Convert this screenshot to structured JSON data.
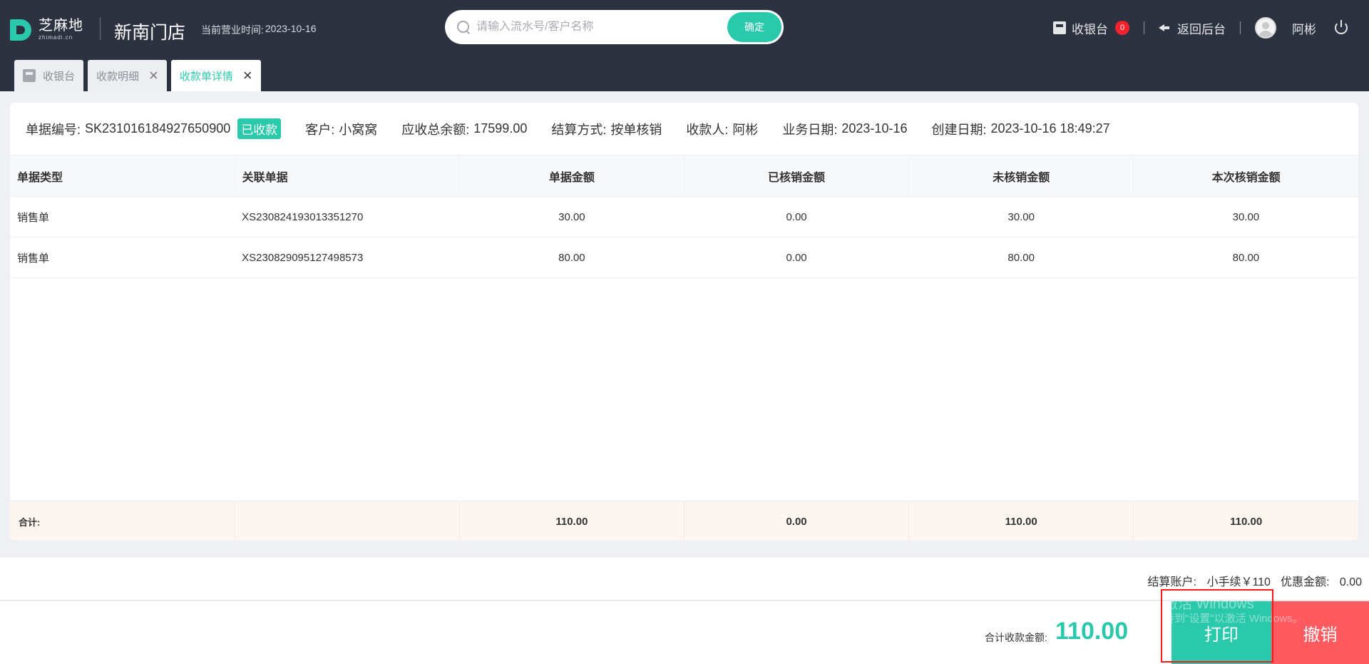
{
  "header": {
    "logo_cn": "芝麻地",
    "logo_en": "zhimadi.cn",
    "store_name": "新南门店",
    "biz_time_label": "当前营业时间:",
    "biz_time_value": "2023-10-16",
    "search_placeholder": "请输入流水号/客户名称",
    "search_button": "确定",
    "cashier_label": "收银台",
    "cashier_badge": "0",
    "back_label": "返回后台",
    "user_name": "阿彬"
  },
  "tabs": [
    {
      "label": "收银台"
    },
    {
      "label": "收款明细"
    },
    {
      "label": "收款单详情"
    }
  ],
  "receipt": {
    "number_label": "单据编号:",
    "number": "SK231016184927650900",
    "status": "已收款",
    "customer_label": "客户:",
    "customer": "小窝窝",
    "balance_label": "应收总余额:",
    "balance": "17599.00",
    "settle_label": "结算方式:",
    "settle": "按单核销",
    "payee_label": "收款人:",
    "payee": "阿彬",
    "biz_date_label": "业务日期:",
    "biz_date": "2023-10-16",
    "created_label": "创建日期:",
    "created": "2023-10-16 18:49:27"
  },
  "table": {
    "headers": [
      "单据类型",
      "关联单据",
      "单据金额",
      "已核销金额",
      "未核销金额",
      "本次核销金额"
    ],
    "rows": [
      [
        "销售单",
        "XS230824193013351270",
        "30.00",
        "0.00",
        "30.00",
        "30.00"
      ],
      [
        "销售单",
        "XS230829095127498573",
        "80.00",
        "0.00",
        "80.00",
        "80.00"
      ]
    ],
    "totals": [
      "合计:",
      "",
      "110.00",
      "0.00",
      "110.00",
      "110.00"
    ]
  },
  "footer": {
    "account_label": "结算账户:",
    "account_value": "小手续￥110",
    "discount_label": "优惠金额:",
    "discount_value": "0.00",
    "total_label": "合计收款金额:",
    "total_value": "110.00",
    "print_button": "打印",
    "cancel_button": "撤销",
    "watermark_line1": "激活 Windows",
    "watermark_line2": "转到\"设置\"以激活 Windows。"
  },
  "colors": {
    "accent": "#2bc9ac",
    "danger": "#ff5a5f",
    "header_bg": "#2d3240"
  }
}
